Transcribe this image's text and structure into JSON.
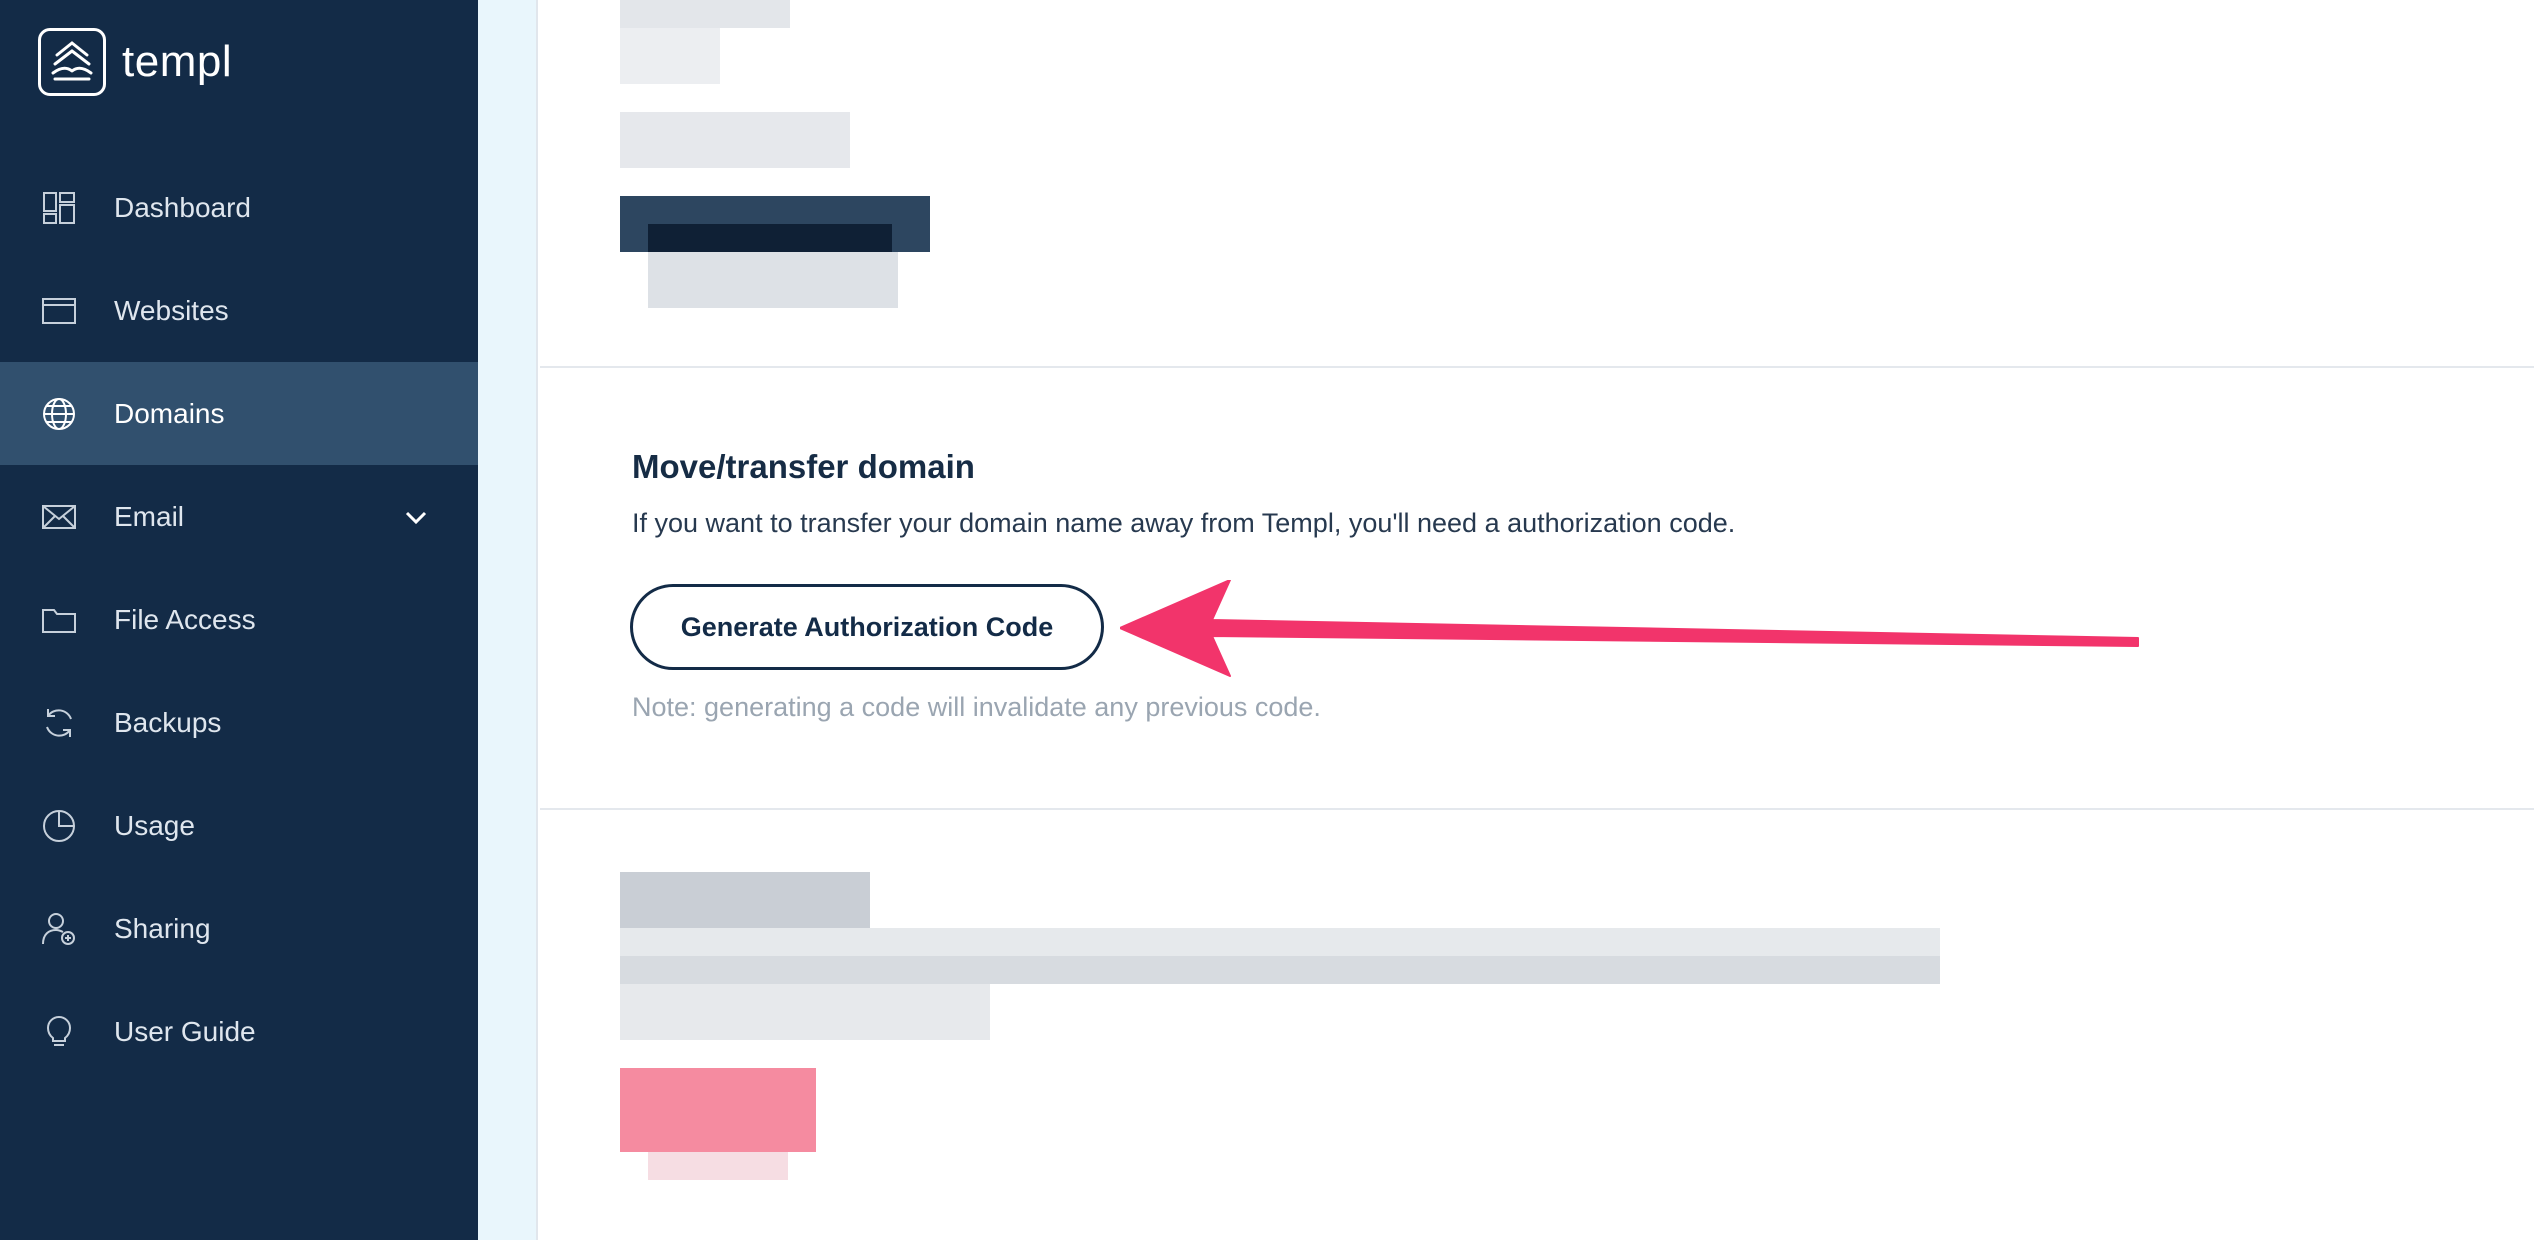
{
  "brand": {
    "name": "templ"
  },
  "sidebar": {
    "items": [
      {
        "label": "Dashboard",
        "icon": "dashboard-icon"
      },
      {
        "label": "Websites",
        "icon": "browser-window-icon"
      },
      {
        "label": "Domains",
        "icon": "globe-icon",
        "active": true
      },
      {
        "label": "Email",
        "icon": "envelope-icon",
        "expandable": true
      },
      {
        "label": "File Access",
        "icon": "folder-icon"
      },
      {
        "label": "Backups",
        "icon": "refresh-icon"
      },
      {
        "label": "Usage",
        "icon": "pie-chart-icon"
      },
      {
        "label": "Sharing",
        "icon": "user-add-icon"
      },
      {
        "label": "User Guide",
        "icon": "lightbulb-icon"
      }
    ]
  },
  "transfer": {
    "title": "Move/transfer domain",
    "description": "If you want to transfer your domain name away from Templ, you'll need a authorization code.",
    "button_label": "Generate Authorization Code",
    "note": "Note: generating a code will invalidate any previous code."
  },
  "colors": {
    "sidebar_bg": "#132b47",
    "sidebar_active": "#31506e",
    "accent_arrow": "#f2346b",
    "strip": "#e9f6fc"
  }
}
